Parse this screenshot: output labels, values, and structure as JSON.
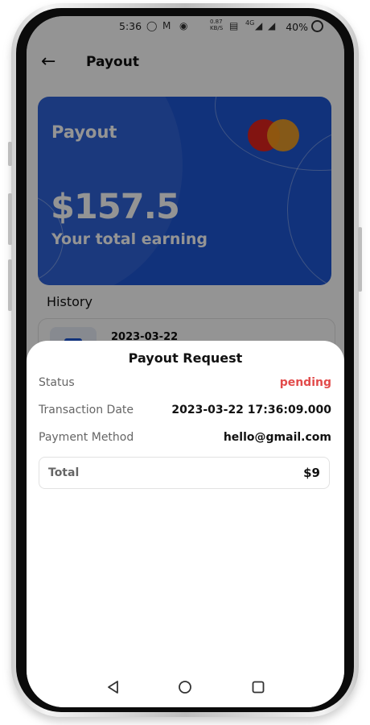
{
  "status_bar": {
    "time": "5:36",
    "speed": "0.87 KB/S",
    "network": "4G",
    "battery": "40%"
  },
  "header": {
    "back_icon": "arrow-left-icon",
    "title": "Payout"
  },
  "card": {
    "label": "Payout",
    "amount": "$157.5",
    "subtitle": "Your total earning",
    "color": "#1e56d4",
    "brand_icon": "mastercard-logo"
  },
  "history": {
    "label": "History",
    "items": [
      {
        "date": "2023-03-22"
      }
    ]
  },
  "sheet": {
    "title": "Payout Request",
    "rows": [
      {
        "label": "Status",
        "value": "pending"
      },
      {
        "label": "Transaction Date",
        "value": "2023-03-22 17:36:09.000"
      },
      {
        "label": "Payment Method",
        "value": "hello@gmail.com"
      }
    ],
    "total_label": "Total",
    "total_value": "$9",
    "status_color": "#e24b4b"
  },
  "nav": {
    "back": "back-triangle-icon",
    "home": "home-circle-icon",
    "recents": "recents-square-icon"
  }
}
